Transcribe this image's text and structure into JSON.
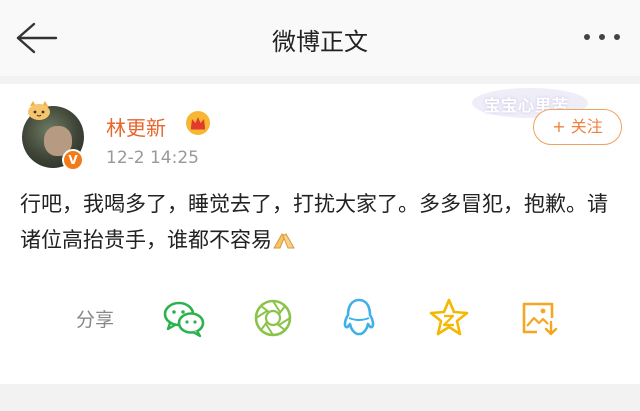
{
  "header": {
    "title": "微博正文",
    "back_icon": "back-arrow-icon",
    "more_icon": "more-dots-icon"
  },
  "post": {
    "author": "林更新",
    "verified_badge": "V",
    "time": "12-2 14:25",
    "follow_label": "+ 关注",
    "watermark": "宝宝心里苦",
    "content": "行吧，我喝多了，睡觉去了，打扰大家了。多多冒犯，抱歉。请诸位高抬贵手，谁都不容易",
    "content_emoji": "praying-hands-emoji"
  },
  "share": {
    "label": "分享",
    "targets": [
      "wechat-icon",
      "moments-icon",
      "qq-icon",
      "qzone-icon",
      "save-image-icon"
    ]
  },
  "colors": {
    "accent": "#f0813d",
    "name": "#e8652b",
    "share_green": "#2bb24c",
    "share_blue": "#3fb0e8",
    "share_yellow": "#f5b800"
  }
}
